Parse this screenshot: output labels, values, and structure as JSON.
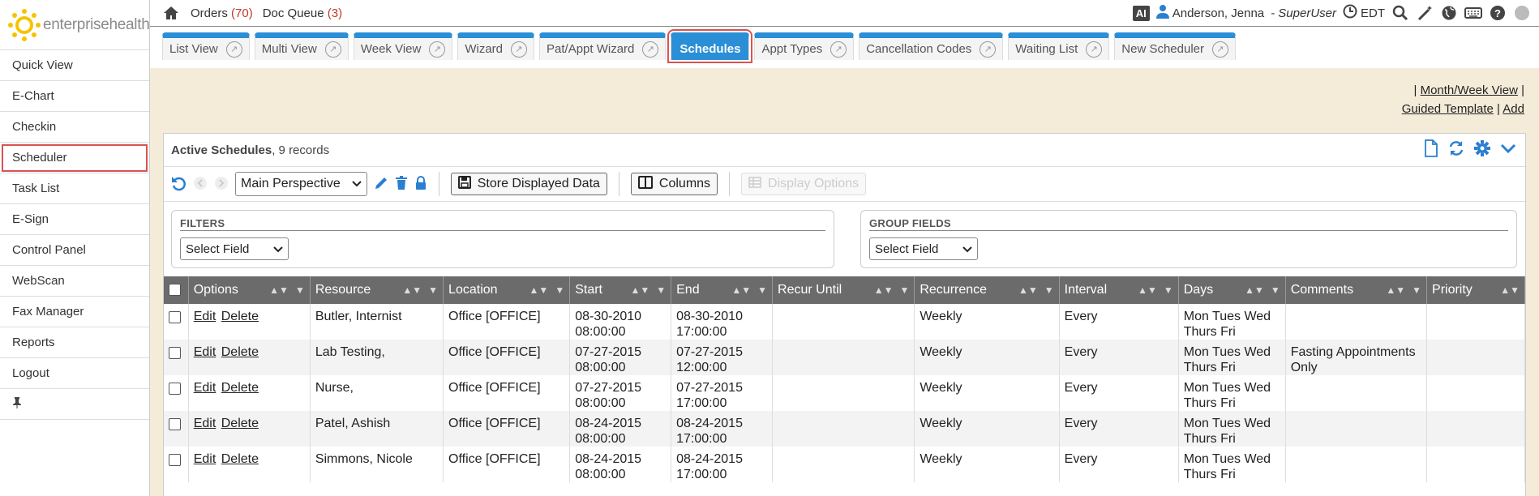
{
  "logo": {
    "text": "enterprisehealth"
  },
  "sidebar": {
    "items": [
      {
        "label": "Quick View"
      },
      {
        "label": "E-Chart"
      },
      {
        "label": "Checkin"
      },
      {
        "label": "Scheduler"
      },
      {
        "label": "Task List"
      },
      {
        "label": "E-Sign"
      },
      {
        "label": "Control Panel"
      },
      {
        "label": "WebScan"
      },
      {
        "label": "Fax Manager"
      },
      {
        "label": "Reports"
      },
      {
        "label": "Logout"
      }
    ]
  },
  "topbar": {
    "orders_label": "Orders",
    "orders_count": "(70)",
    "docqueue_label": "Doc Queue",
    "docqueue_count": "(3)",
    "ai_badge": "AI",
    "user_name": "Anderson, Jenna",
    "user_role": "- SuperUser",
    "timezone": "EDT"
  },
  "tabs": [
    {
      "label": "List View"
    },
    {
      "label": "Multi View"
    },
    {
      "label": "Week View"
    },
    {
      "label": "Wizard"
    },
    {
      "label": "Pat/Appt Wizard"
    },
    {
      "label": "Schedules"
    },
    {
      "label": "Appt Types"
    },
    {
      "label": "Cancellation Codes"
    },
    {
      "label": "Waiting List"
    },
    {
      "label": "New Scheduler"
    }
  ],
  "links": {
    "month_week": "Month/Week View",
    "guided": "Guided Template",
    "add": "Add"
  },
  "panel": {
    "title": "Active Schedules",
    "records": ", 9 records",
    "perspective": "Main Perspective",
    "store_btn": "Store Displayed Data",
    "columns_btn": "Columns",
    "display_options": "Display Options",
    "filters_label": "FILTERS",
    "group_label": "GROUP FIELDS",
    "select_field": "Select Field"
  },
  "table": {
    "headers": [
      "Options",
      "Resource",
      "Location",
      "Start",
      "End",
      "Recur Until",
      "Recurrence",
      "Interval",
      "Days",
      "Comments",
      "Priority"
    ],
    "edit": "Edit",
    "delete": "Delete",
    "rows": [
      {
        "resource": "Butler, Internist",
        "location": "Office [OFFICE]",
        "start1": "08-30-2010",
        "start2": "08:00:00",
        "end1": "08-30-2010",
        "end2": "17:00:00",
        "recur_until": "",
        "recurrence": "Weekly",
        "interval": "Every",
        "days1": "Mon Tues Wed",
        "days2": "Thurs Fri",
        "comments1": "",
        "comments2": "",
        "priority": ""
      },
      {
        "resource": "Lab Testing,",
        "location": "Office [OFFICE]",
        "start1": "07-27-2015",
        "start2": "08:00:00",
        "end1": "07-27-2015",
        "end2": "12:00:00",
        "recur_until": "",
        "recurrence": "Weekly",
        "interval": "Every",
        "days1": "Mon Tues Wed",
        "days2": "Thurs Fri",
        "comments1": "Fasting Appointments",
        "comments2": "Only",
        "priority": ""
      },
      {
        "resource": "Nurse,",
        "location": "Office [OFFICE]",
        "start1": "07-27-2015",
        "start2": "08:00:00",
        "end1": "07-27-2015",
        "end2": "17:00:00",
        "recur_until": "",
        "recurrence": "Weekly",
        "interval": "Every",
        "days1": "Mon Tues Wed",
        "days2": "Thurs Fri",
        "comments1": "",
        "comments2": "",
        "priority": ""
      },
      {
        "resource": "Patel, Ashish",
        "location": "Office [OFFICE]",
        "start1": "08-24-2015",
        "start2": "08:00:00",
        "end1": "08-24-2015",
        "end2": "17:00:00",
        "recur_until": "",
        "recurrence": "Weekly",
        "interval": "Every",
        "days1": "Mon Tues Wed",
        "days2": "Thurs Fri",
        "comments1": "",
        "comments2": "",
        "priority": ""
      },
      {
        "resource": "Simmons, Nicole",
        "location": "Office [OFFICE]",
        "start1": "08-24-2015",
        "start2": "08:00:00",
        "end1": "08-24-2015",
        "end2": "17:00:00",
        "recur_until": "",
        "recurrence": "Weekly",
        "interval": "Every",
        "days1": "Mon Tues Wed",
        "days2": "Thurs Fri",
        "comments1": "",
        "comments2": "",
        "priority": ""
      }
    ]
  }
}
